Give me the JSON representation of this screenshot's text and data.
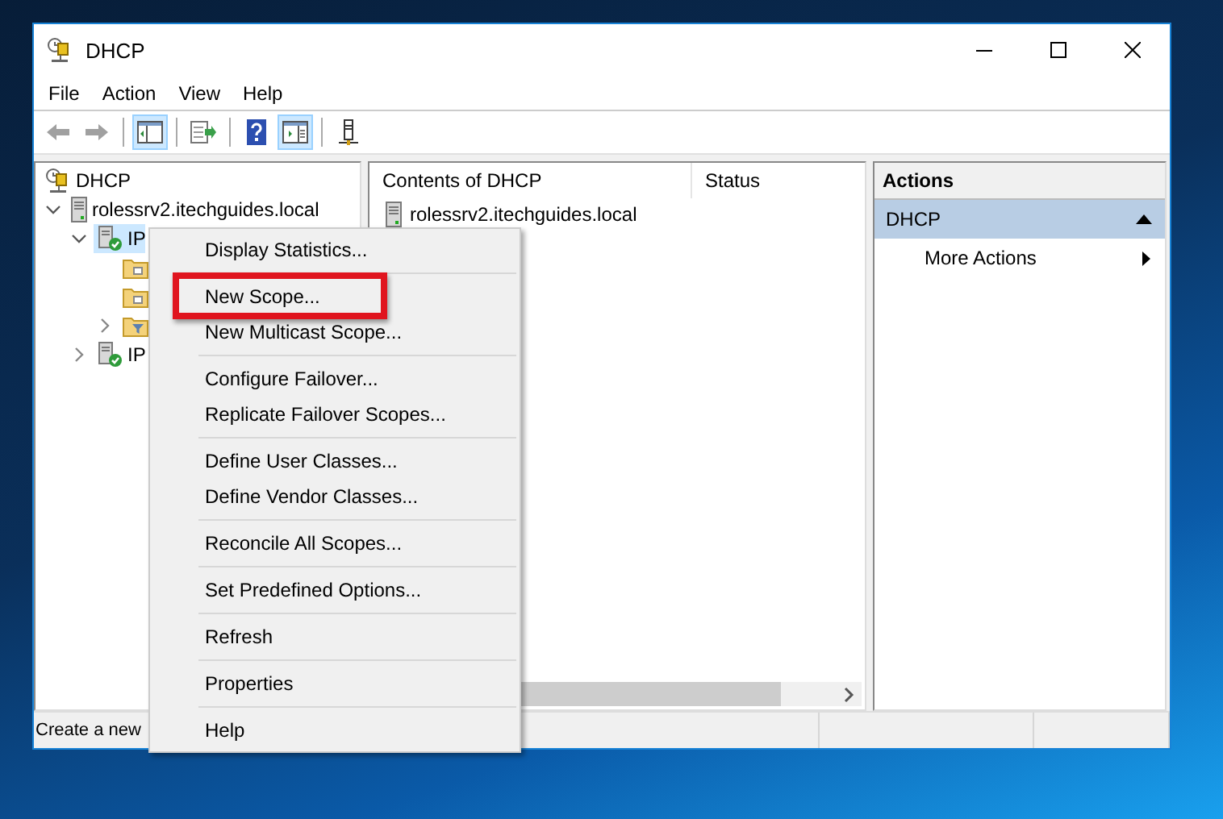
{
  "window": {
    "title": "DHCP"
  },
  "menu_bar": [
    "File",
    "Action",
    "View",
    "Help"
  ],
  "toolbar": [
    {
      "kind": "back",
      "disabled": true
    },
    {
      "kind": "forward",
      "disabled": true
    },
    {
      "kind": "separator"
    },
    {
      "kind": "tree",
      "pressed": true
    },
    {
      "kind": "separator"
    },
    {
      "kind": "export",
      "pressed": false
    },
    {
      "kind": "separator"
    },
    {
      "kind": "help",
      "pressed": false
    },
    {
      "kind": "action-pane",
      "pressed": true
    },
    {
      "kind": "separator"
    },
    {
      "kind": "server",
      "pressed": false
    }
  ],
  "tree": [
    {
      "label": "DHCP",
      "kind": "dhcp",
      "selected": false,
      "children": [
        {
          "label": "rolessrv2.itechguides.local",
          "kind": "server",
          "expanded": true,
          "selected": false,
          "children": [
            {
              "label": "IP",
              "kind": "ip",
              "expanded": true,
              "selected": true,
              "children": [
                {
                  "kind": "folder",
                  "selected": false
                },
                {
                  "kind": "folder",
                  "selected": false
                },
                {
                  "kind": "filter",
                  "expanded": false,
                  "selected": false
                }
              ]
            },
            {
              "label": "IP",
              "kind": "ip",
              "expanded": false,
              "selected": false
            }
          ]
        }
      ]
    }
  ],
  "contents": {
    "columns": [
      "Contents of DHCP",
      "Status"
    ],
    "rows": [
      {
        "name": "rolessrv2.itechguides.local",
        "status": ""
      }
    ]
  },
  "actions": {
    "title": "Actions",
    "sections": [
      {
        "label": "DHCP",
        "expanded": true,
        "items": [
          {
            "label": "More Actions",
            "submenu": true
          }
        ]
      }
    ]
  },
  "status_bar": {
    "text": "Create a new"
  },
  "context_menu": {
    "groups": [
      [
        {
          "label": "Display Statistics...",
          "highlighted": false
        }
      ],
      [
        {
          "label": "New Scope...",
          "highlighted": true
        },
        {
          "label": "New Multicast Scope...",
          "highlighted": false
        }
      ],
      [
        {
          "label": "Configure Failover...",
          "highlighted": false
        },
        {
          "label": "Replicate Failover Scopes...",
          "highlighted": false
        }
      ],
      [
        {
          "label": "Define User Classes...",
          "highlighted": false
        },
        {
          "label": "Define Vendor Classes...",
          "highlighted": false
        }
      ],
      [
        {
          "label": "Reconcile All Scopes...",
          "highlighted": false
        }
      ],
      [
        {
          "label": "Set Predefined Options...",
          "highlighted": false
        }
      ],
      [
        {
          "label": "Refresh",
          "highlighted": false
        }
      ],
      [
        {
          "label": "Properties",
          "highlighted": false
        }
      ],
      [
        {
          "label": "Help",
          "highlighted": false
        }
      ]
    ]
  }
}
